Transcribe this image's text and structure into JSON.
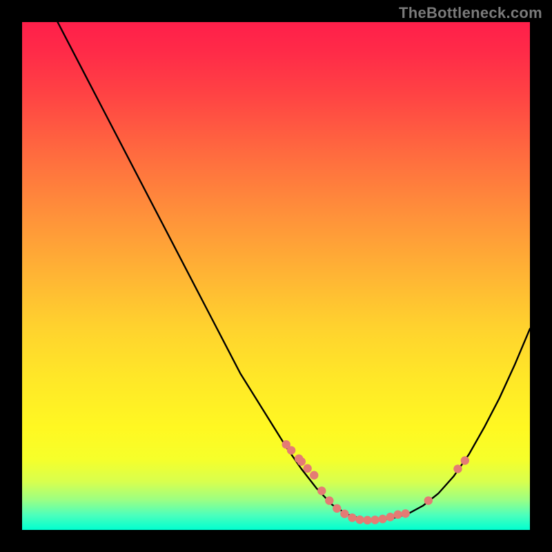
{
  "watermark": "TheBottleneck.com",
  "chart_data": {
    "type": "line",
    "title": "",
    "xlabel": "",
    "ylabel": "",
    "xlim": [
      0,
      100
    ],
    "ylim": [
      -2,
      102
    ],
    "grid": false,
    "legend": false,
    "curve": {
      "name": "bottleneck-curve",
      "x": [
        7,
        10,
        13,
        16,
        19,
        22,
        25,
        28,
        31,
        34,
        37,
        40,
        43,
        46,
        49,
        52,
        55,
        58,
        61,
        64,
        67,
        70,
        73,
        76,
        79,
        82,
        85,
        88,
        91,
        94,
        97,
        100
      ],
      "y": [
        102,
        96,
        90,
        84,
        78,
        72,
        66,
        60,
        54,
        48,
        42,
        36,
        30,
        25,
        20,
        15,
        10.5,
        6.5,
        3.2,
        1.2,
        0.2,
        0,
        0.4,
        1.3,
        3.0,
        5.5,
        9.0,
        13.5,
        19.0,
        25.0,
        31.8,
        39.2
      ]
    },
    "highlight_points": {
      "name": "sample-points",
      "color": "#e47b74",
      "x": [
        52,
        53,
        54.5,
        55,
        56.2,
        57.5,
        59,
        60.5,
        62,
        63.5,
        65,
        66.5,
        68,
        69.5,
        71,
        72.5,
        74,
        75.5,
        80,
        85.8,
        87.2
      ],
      "y": [
        15.5,
        14.3,
        12.6,
        12.0,
        10.6,
        9.2,
        6.0,
        4.0,
        2.4,
        1.3,
        0.5,
        0.1,
        0.0,
        0.05,
        0.25,
        0.65,
        1.15,
        1.35,
        4.0,
        10.5,
        12.2
      ]
    },
    "highlight_radius": 6.2
  }
}
